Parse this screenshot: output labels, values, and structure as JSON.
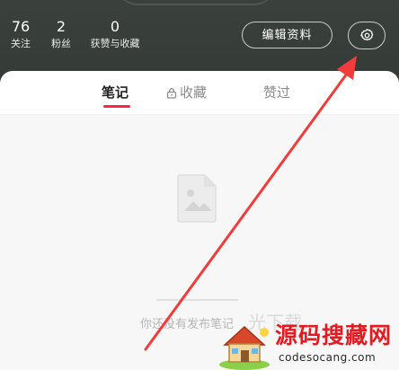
{
  "profile": {
    "stats": [
      {
        "value": "76",
        "label": "关注"
      },
      {
        "value": "2",
        "label": "粉丝"
      },
      {
        "value": "0",
        "label": "获赞与收藏"
      }
    ],
    "edit_label": "编辑资料",
    "settings_icon": "gear-icon"
  },
  "tabs": [
    {
      "label": "笔记",
      "active": true
    },
    {
      "label": "收藏",
      "locked": true
    },
    {
      "label": "赞过"
    }
  ],
  "empty_state": {
    "icon": "empty-note-icon",
    "text": "你还没有发布笔记",
    "partial_overlay_text": "光下载"
  },
  "watermark": {
    "title": "源码搜藏网",
    "subtitle": "codesocang.com"
  },
  "colors": {
    "header_bg": "#383e39",
    "accent": "#ff2442",
    "arrow": "#f23b3b",
    "watermark_red": "#e11b22"
  }
}
